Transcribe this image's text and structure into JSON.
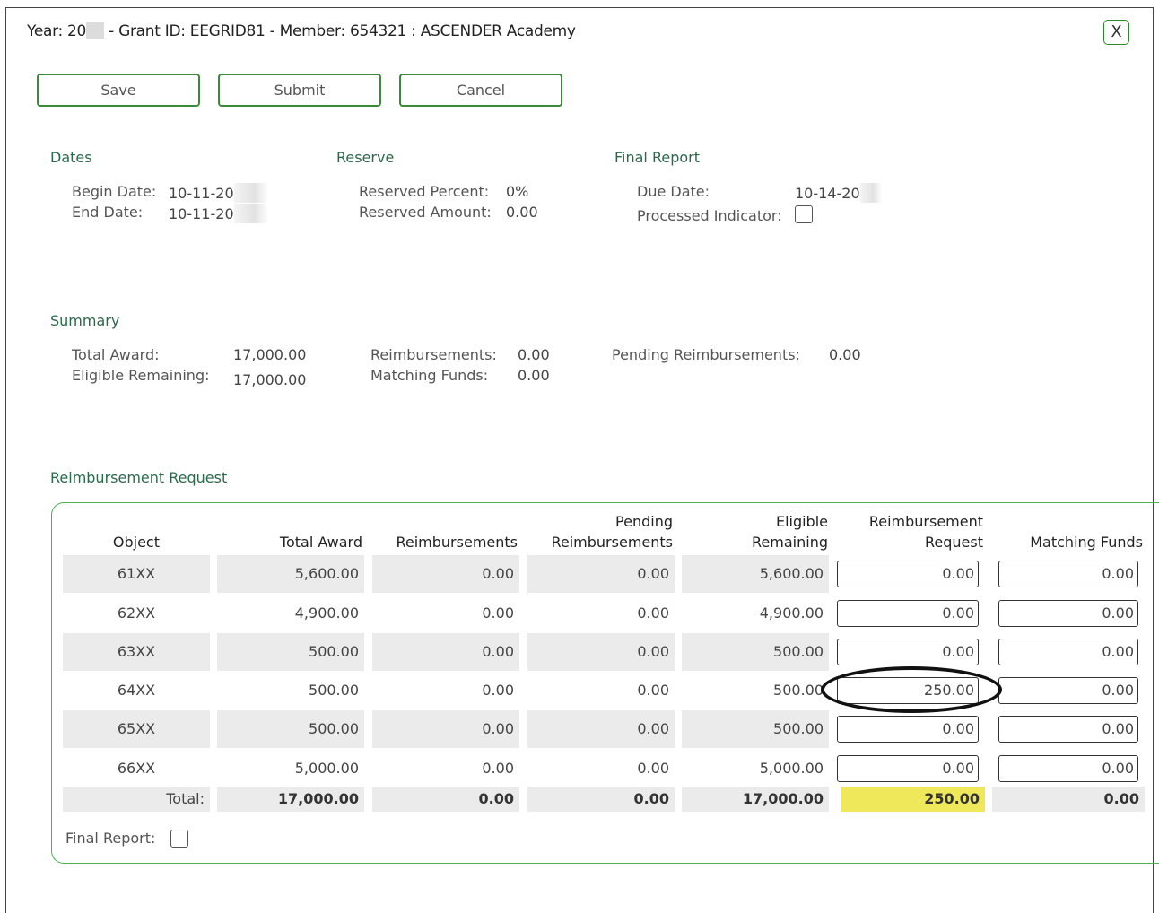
{
  "header": {
    "title_year": "Year: 20",
    "title_rest": "- Grant ID: EEGRID81 - Member: 654321 : ASCENDER Academy",
    "close_label": "X"
  },
  "toolbar": {
    "save_label": "Save",
    "submit_label": "Submit",
    "cancel_label": "Cancel"
  },
  "dates": {
    "title": "Dates",
    "begin_label": "Begin Date:",
    "begin_value": "10-11-20",
    "end_label": "End Date:",
    "end_value": "10-11-20"
  },
  "reserve": {
    "title": "Reserve",
    "percent_label": "Reserved Percent:",
    "percent_value": "0%",
    "amount_label": "Reserved Amount:",
    "amount_value": "0.00"
  },
  "final_report": {
    "title": "Final Report",
    "due_label": "Due Date:",
    "due_value": "10-14-20",
    "processed_label": "Processed Indicator:",
    "processed_checked": false
  },
  "summary": {
    "title": "Summary",
    "total_award_label": "Total Award:",
    "total_award_value": "17,000.00",
    "eligible_label": "Eligible Remaining:",
    "eligible_value": "17,000.00",
    "reimb_label": "Reimbursements:",
    "reimb_value": "0.00",
    "matching_label": "Matching Funds:",
    "matching_value": "0.00",
    "pending_label": "Pending Reimbursements:",
    "pending_value": "0.00"
  },
  "reimbursement": {
    "title": "Reimbursement Request",
    "headers": {
      "object": "Object",
      "total_award": "Total Award",
      "reimbursements": "Reimbursements",
      "pending_1": "Pending",
      "pending_2": "Reimbursements",
      "eligible_1": "Eligible",
      "eligible_2": "Remaining",
      "request_1": "Reimbursement",
      "request_2": "Request",
      "matching": "Matching Funds"
    },
    "rows": [
      {
        "object": "61XX",
        "total_award": "5,600.00",
        "reimbursements": "0.00",
        "pending": "0.00",
        "eligible": "5,600.00",
        "request": "0.00",
        "matching": "0.00"
      },
      {
        "object": "62XX",
        "total_award": "4,900.00",
        "reimbursements": "0.00",
        "pending": "0.00",
        "eligible": "4,900.00",
        "request": "0.00",
        "matching": "0.00"
      },
      {
        "object": "63XX",
        "total_award": "500.00",
        "reimbursements": "0.00",
        "pending": "0.00",
        "eligible": "500.00",
        "request": "0.00",
        "matching": "0.00"
      },
      {
        "object": "64XX",
        "total_award": "500.00",
        "reimbursements": "0.00",
        "pending": "0.00",
        "eligible": "500.00",
        "request": "250.00",
        "matching": "0.00"
      },
      {
        "object": "65XX",
        "total_award": "500.00",
        "reimbursements": "0.00",
        "pending": "0.00",
        "eligible": "500.00",
        "request": "0.00",
        "matching": "0.00"
      },
      {
        "object": "66XX",
        "total_award": "5,000.00",
        "reimbursements": "0.00",
        "pending": "0.00",
        "eligible": "5,000.00",
        "request": "0.00",
        "matching": "0.00"
      }
    ],
    "totals": {
      "label": "Total:",
      "total_award": "17,000.00",
      "reimbursements": "0.00",
      "pending": "0.00",
      "eligible": "17,000.00",
      "request": "250.00",
      "matching": "0.00"
    },
    "final_report_label": "Final Report:",
    "final_report_checked": false,
    "highlight_color": "#eee85a"
  }
}
